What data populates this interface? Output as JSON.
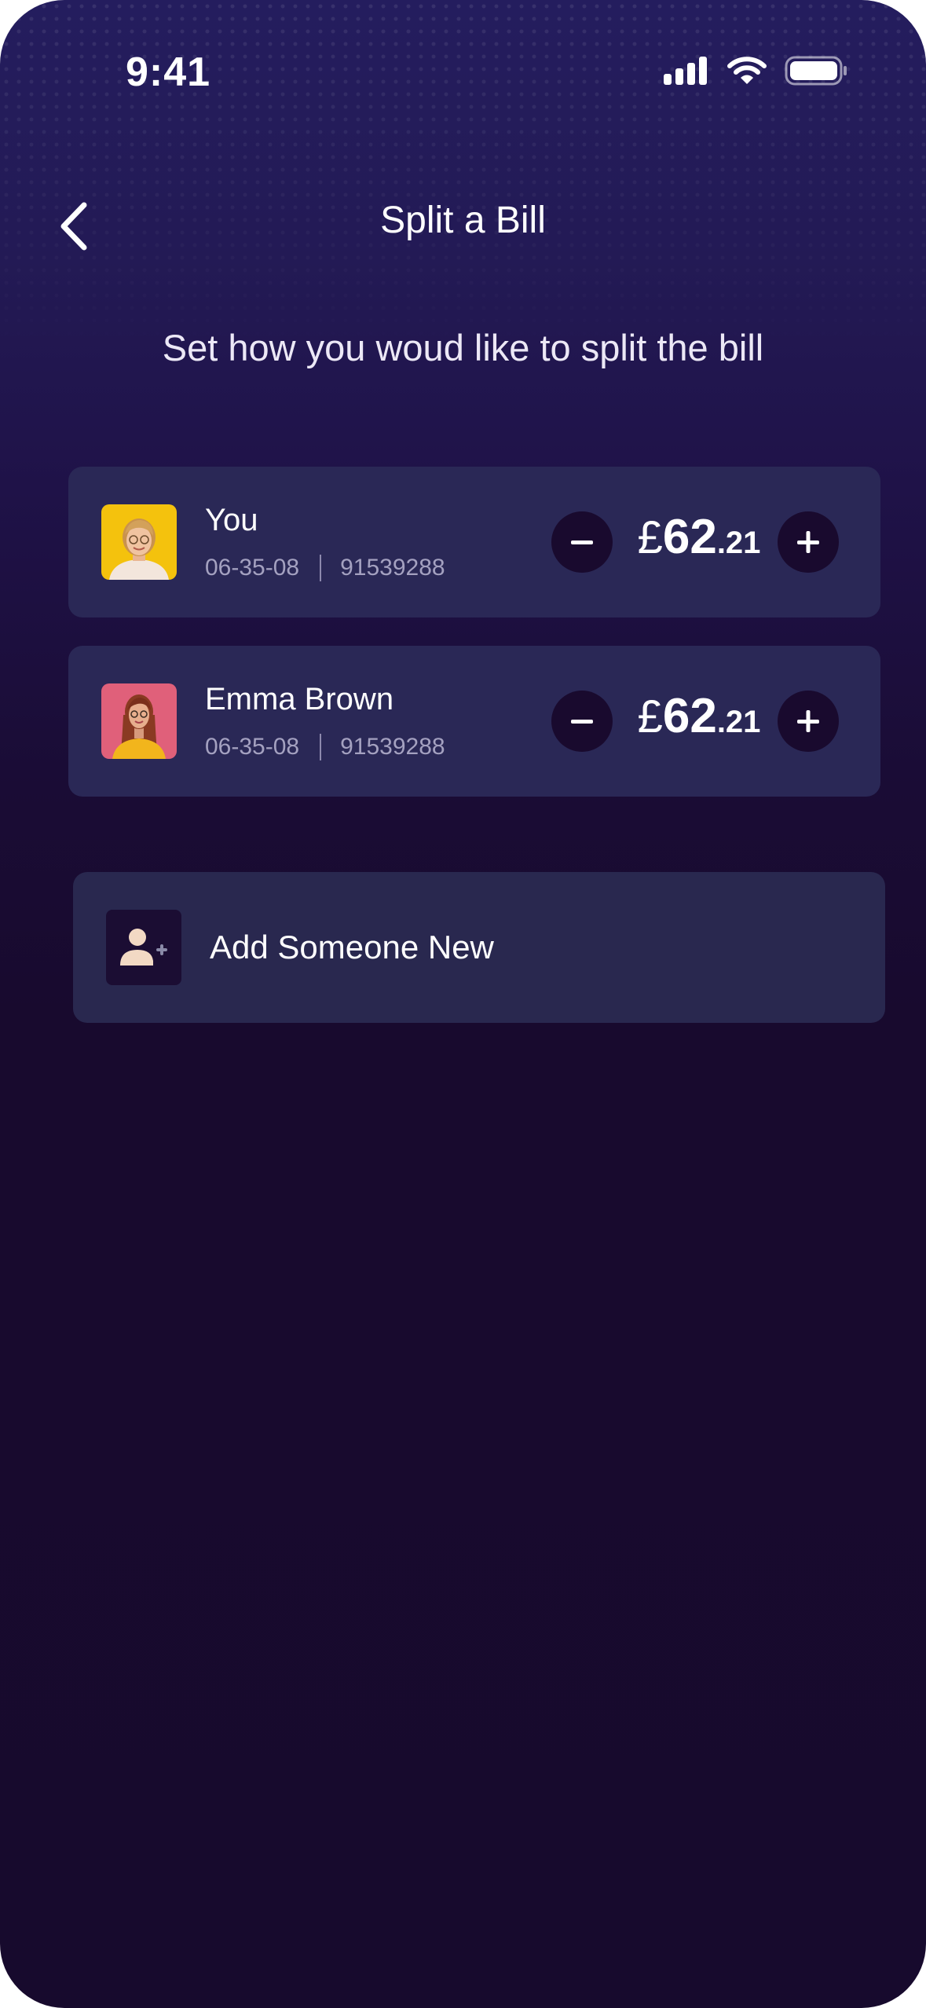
{
  "status_bar": {
    "time": "9:41"
  },
  "header": {
    "title": "Split a Bill",
    "subtitle": "Set how you woud like to split the bill"
  },
  "people": [
    {
      "name": "You",
      "sort_code": "06-35-08",
      "account_number": "91539288",
      "currency": "£",
      "amount_whole": "62",
      "amount_fraction": ".21",
      "avatar_bg": "#f4c20d"
    },
    {
      "name": "Emma Brown",
      "sort_code": "06-35-08",
      "account_number": "91539288",
      "currency": "£",
      "amount_whole": "62",
      "amount_fraction": ".21",
      "avatar_bg": "#e0607a"
    }
  ],
  "add_person": {
    "label": "Add Someone New"
  },
  "icons": {
    "back": "chevron-left-icon",
    "minus": "minus-icon",
    "plus": "plus-icon",
    "add_user": "add-user-icon"
  },
  "colors": {
    "background_top": "#241d5e",
    "background_bottom": "#170a2d",
    "card": "#2a2856",
    "button": "#190a2e",
    "text_secondary": "#a4a1c0"
  }
}
